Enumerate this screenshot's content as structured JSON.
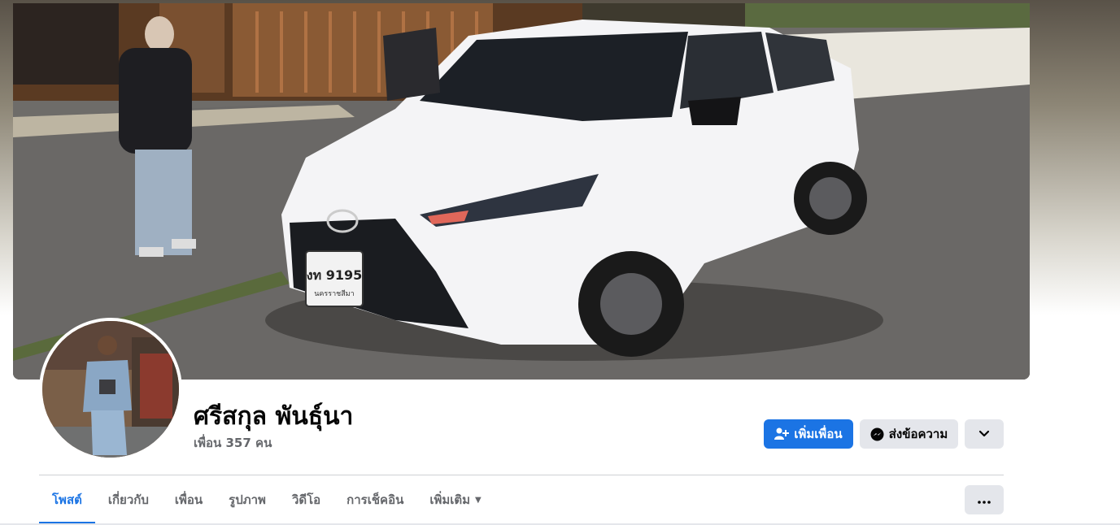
{
  "profile": {
    "name": "ศรีสกุล พันธุ์นา",
    "friends_text": "เพื่อน 357 คน"
  },
  "cover": {
    "plate_text": "งท 9195",
    "plate_province": "นครราชสีมา"
  },
  "actions": {
    "add_friend": "เพิ่มเพื่อน",
    "message": "ส่งข้อความ"
  },
  "tabs": [
    {
      "label": "โพสต์",
      "active": true
    },
    {
      "label": "เกี่ยวกับ",
      "active": false
    },
    {
      "label": "เพื่อน",
      "active": false
    },
    {
      "label": "รูปภาพ",
      "active": false
    },
    {
      "label": "วิดีโอ",
      "active": false
    },
    {
      "label": "การเช็คอิน",
      "active": false
    },
    {
      "label": "เพิ่มเติม",
      "active": false
    }
  ],
  "icons": {
    "add_friend": "person-plus-icon",
    "message": "messenger-icon",
    "dropdown": "chevron-down-icon",
    "more": "ellipsis-icon",
    "tab_more": "caret-down-icon"
  },
  "colors": {
    "accent": "#1b74e4",
    "secondary_button": "#e4e6eb",
    "text_primary": "#050505",
    "text_secondary": "#65676b"
  }
}
